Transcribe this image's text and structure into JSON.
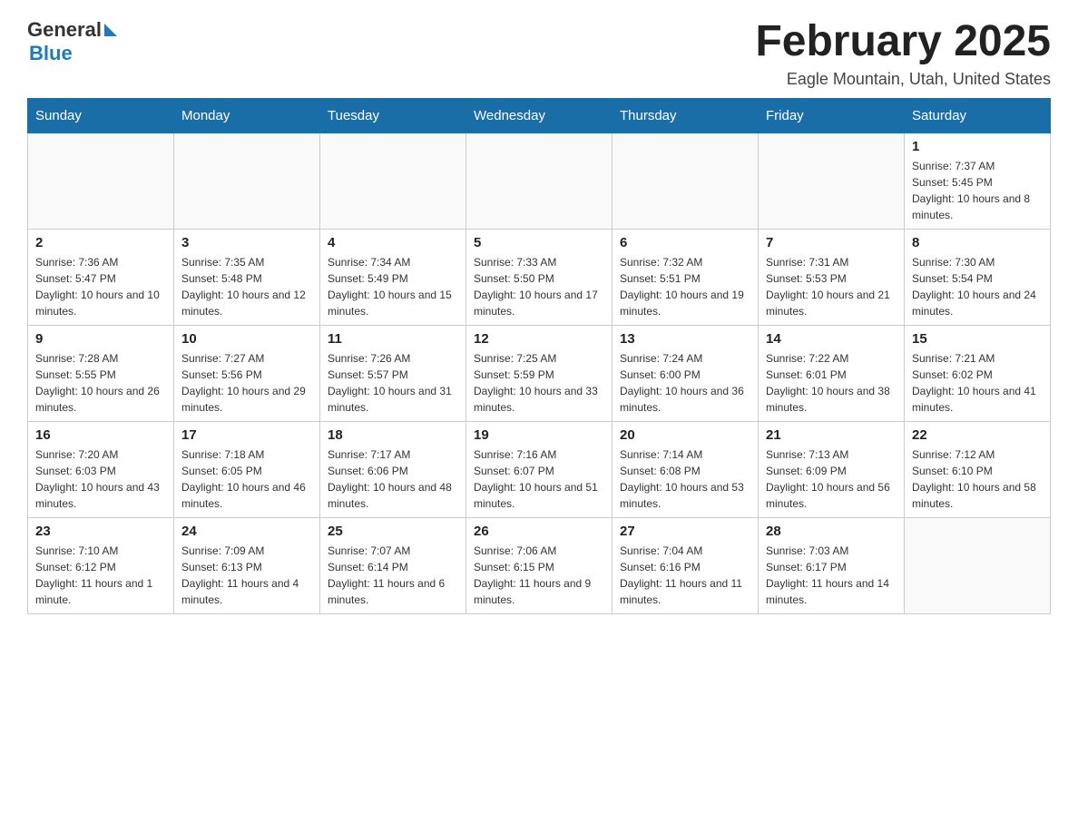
{
  "header": {
    "logo_general": "General",
    "logo_blue": "Blue",
    "month_title": "February 2025",
    "location": "Eagle Mountain, Utah, United States"
  },
  "weekdays": [
    "Sunday",
    "Monday",
    "Tuesday",
    "Wednesday",
    "Thursday",
    "Friday",
    "Saturday"
  ],
  "weeks": [
    [
      {
        "day": "",
        "sunrise": "",
        "sunset": "",
        "daylight": ""
      },
      {
        "day": "",
        "sunrise": "",
        "sunset": "",
        "daylight": ""
      },
      {
        "day": "",
        "sunrise": "",
        "sunset": "",
        "daylight": ""
      },
      {
        "day": "",
        "sunrise": "",
        "sunset": "",
        "daylight": ""
      },
      {
        "day": "",
        "sunrise": "",
        "sunset": "",
        "daylight": ""
      },
      {
        "day": "",
        "sunrise": "",
        "sunset": "",
        "daylight": ""
      },
      {
        "day": "1",
        "sunrise": "Sunrise: 7:37 AM",
        "sunset": "Sunset: 5:45 PM",
        "daylight": "Daylight: 10 hours and 8 minutes."
      }
    ],
    [
      {
        "day": "2",
        "sunrise": "Sunrise: 7:36 AM",
        "sunset": "Sunset: 5:47 PM",
        "daylight": "Daylight: 10 hours and 10 minutes."
      },
      {
        "day": "3",
        "sunrise": "Sunrise: 7:35 AM",
        "sunset": "Sunset: 5:48 PM",
        "daylight": "Daylight: 10 hours and 12 minutes."
      },
      {
        "day": "4",
        "sunrise": "Sunrise: 7:34 AM",
        "sunset": "Sunset: 5:49 PM",
        "daylight": "Daylight: 10 hours and 15 minutes."
      },
      {
        "day": "5",
        "sunrise": "Sunrise: 7:33 AM",
        "sunset": "Sunset: 5:50 PM",
        "daylight": "Daylight: 10 hours and 17 minutes."
      },
      {
        "day": "6",
        "sunrise": "Sunrise: 7:32 AM",
        "sunset": "Sunset: 5:51 PM",
        "daylight": "Daylight: 10 hours and 19 minutes."
      },
      {
        "day": "7",
        "sunrise": "Sunrise: 7:31 AM",
        "sunset": "Sunset: 5:53 PM",
        "daylight": "Daylight: 10 hours and 21 minutes."
      },
      {
        "day": "8",
        "sunrise": "Sunrise: 7:30 AM",
        "sunset": "Sunset: 5:54 PM",
        "daylight": "Daylight: 10 hours and 24 minutes."
      }
    ],
    [
      {
        "day": "9",
        "sunrise": "Sunrise: 7:28 AM",
        "sunset": "Sunset: 5:55 PM",
        "daylight": "Daylight: 10 hours and 26 minutes."
      },
      {
        "day": "10",
        "sunrise": "Sunrise: 7:27 AM",
        "sunset": "Sunset: 5:56 PM",
        "daylight": "Daylight: 10 hours and 29 minutes."
      },
      {
        "day": "11",
        "sunrise": "Sunrise: 7:26 AM",
        "sunset": "Sunset: 5:57 PM",
        "daylight": "Daylight: 10 hours and 31 minutes."
      },
      {
        "day": "12",
        "sunrise": "Sunrise: 7:25 AM",
        "sunset": "Sunset: 5:59 PM",
        "daylight": "Daylight: 10 hours and 33 minutes."
      },
      {
        "day": "13",
        "sunrise": "Sunrise: 7:24 AM",
        "sunset": "Sunset: 6:00 PM",
        "daylight": "Daylight: 10 hours and 36 minutes."
      },
      {
        "day": "14",
        "sunrise": "Sunrise: 7:22 AM",
        "sunset": "Sunset: 6:01 PM",
        "daylight": "Daylight: 10 hours and 38 minutes."
      },
      {
        "day": "15",
        "sunrise": "Sunrise: 7:21 AM",
        "sunset": "Sunset: 6:02 PM",
        "daylight": "Daylight: 10 hours and 41 minutes."
      }
    ],
    [
      {
        "day": "16",
        "sunrise": "Sunrise: 7:20 AM",
        "sunset": "Sunset: 6:03 PM",
        "daylight": "Daylight: 10 hours and 43 minutes."
      },
      {
        "day": "17",
        "sunrise": "Sunrise: 7:18 AM",
        "sunset": "Sunset: 6:05 PM",
        "daylight": "Daylight: 10 hours and 46 minutes."
      },
      {
        "day": "18",
        "sunrise": "Sunrise: 7:17 AM",
        "sunset": "Sunset: 6:06 PM",
        "daylight": "Daylight: 10 hours and 48 minutes."
      },
      {
        "day": "19",
        "sunrise": "Sunrise: 7:16 AM",
        "sunset": "Sunset: 6:07 PM",
        "daylight": "Daylight: 10 hours and 51 minutes."
      },
      {
        "day": "20",
        "sunrise": "Sunrise: 7:14 AM",
        "sunset": "Sunset: 6:08 PM",
        "daylight": "Daylight: 10 hours and 53 minutes."
      },
      {
        "day": "21",
        "sunrise": "Sunrise: 7:13 AM",
        "sunset": "Sunset: 6:09 PM",
        "daylight": "Daylight: 10 hours and 56 minutes."
      },
      {
        "day": "22",
        "sunrise": "Sunrise: 7:12 AM",
        "sunset": "Sunset: 6:10 PM",
        "daylight": "Daylight: 10 hours and 58 minutes."
      }
    ],
    [
      {
        "day": "23",
        "sunrise": "Sunrise: 7:10 AM",
        "sunset": "Sunset: 6:12 PM",
        "daylight": "Daylight: 11 hours and 1 minute."
      },
      {
        "day": "24",
        "sunrise": "Sunrise: 7:09 AM",
        "sunset": "Sunset: 6:13 PM",
        "daylight": "Daylight: 11 hours and 4 minutes."
      },
      {
        "day": "25",
        "sunrise": "Sunrise: 7:07 AM",
        "sunset": "Sunset: 6:14 PM",
        "daylight": "Daylight: 11 hours and 6 minutes."
      },
      {
        "day": "26",
        "sunrise": "Sunrise: 7:06 AM",
        "sunset": "Sunset: 6:15 PM",
        "daylight": "Daylight: 11 hours and 9 minutes."
      },
      {
        "day": "27",
        "sunrise": "Sunrise: 7:04 AM",
        "sunset": "Sunset: 6:16 PM",
        "daylight": "Daylight: 11 hours and 11 minutes."
      },
      {
        "day": "28",
        "sunrise": "Sunrise: 7:03 AM",
        "sunset": "Sunset: 6:17 PM",
        "daylight": "Daylight: 11 hours and 14 minutes."
      },
      {
        "day": "",
        "sunrise": "",
        "sunset": "",
        "daylight": ""
      }
    ]
  ]
}
